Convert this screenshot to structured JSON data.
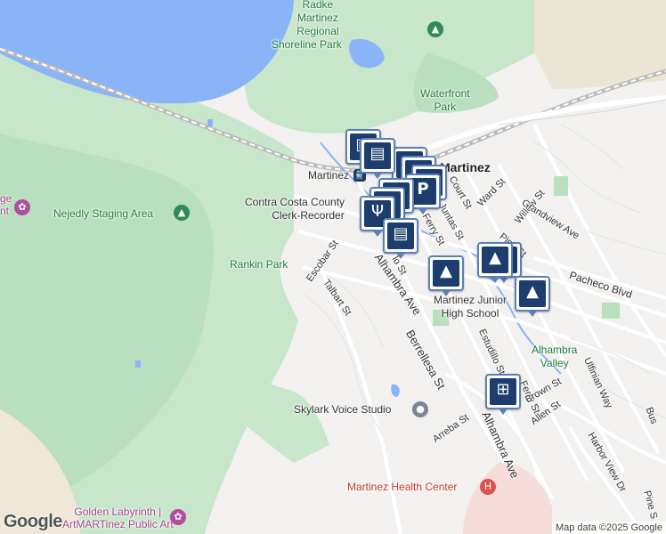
{
  "map": {
    "attribution": "Map data ©2025 Google",
    "brand": "Google",
    "labels": {
      "radke_1": "Radke",
      "radke_2": "Martinez",
      "radke_3": "Regional",
      "radke_4": "Shoreline Park",
      "waterfront_1": "Waterfront",
      "waterfront_2": "Park",
      "martinez_station": "Martinez",
      "martinez_city": "Martinez",
      "contra_costa_1": "Contra Costa County",
      "contra_costa_2": "Clerk-Recorder",
      "nejedly": "Nejedly Staging Area",
      "rankin": "Rankin Park",
      "junior_high_1": "Martinez Junior",
      "junior_high_2": "High School",
      "alhambra_valley_1": "Alhambra",
      "alhambra_valley_2": "Valley",
      "skylark": "Skylark Voice Studio",
      "health_center": "Martinez Health Center",
      "golden_1": "Golden Labyrinth |",
      "golden_2": "ArtMARTinez Public Art",
      "left_edge_1": "ge",
      "left_edge_2": "nt"
    },
    "streets": {
      "escobar": "Escobar St",
      "talbart": "Talbart St",
      "alhambra_ave_1": "Alhambra Ave",
      "alhambra_ave_2": "Alhambra Ave",
      "berrellesa": "Berrellesa St",
      "court": "Court St",
      "ward": "Ward St",
      "las_juntas": "Las Juntas St",
      "ferry_1": "Ferry St",
      "ferry_2": "Ferry St",
      "willow": "Willow St",
      "grandview": "Grandview Ave",
      "pine_1": "Pine St",
      "pine_2": "Pine S",
      "pacheco": "Pacheco Blvd",
      "estudillo": "Estudillo St",
      "brown": "Brown St",
      "allen": "Allen St",
      "arreba": "Arreba St",
      "ulfinian": "Ulfinian Way",
      "harbor_view": "Harbor View Dr",
      "bus": "Bus",
      "mello": "lo St"
    },
    "icons": [
      {
        "name": "shopping-bag-icon",
        "glyph": "🛍"
      },
      {
        "name": "fork-knife-icon",
        "glyph": "🍴"
      },
      {
        "name": "parking-icon",
        "glyph": "P"
      },
      {
        "name": "graduation-cap-icon",
        "glyph": "🎓"
      },
      {
        "name": "shopping-cart-icon",
        "glyph": "🛒"
      },
      {
        "name": "computer-icon",
        "glyph": "🖥"
      }
    ],
    "colors": {
      "water": "#8ab4f8",
      "park": "#c3e6cb",
      "land": "#f2f1ef",
      "pin_border": "#5b7fb8",
      "pin_fill": "#1c3d6d",
      "park_text": "#1e7b3c",
      "hospital": "#d9534f"
    }
  }
}
